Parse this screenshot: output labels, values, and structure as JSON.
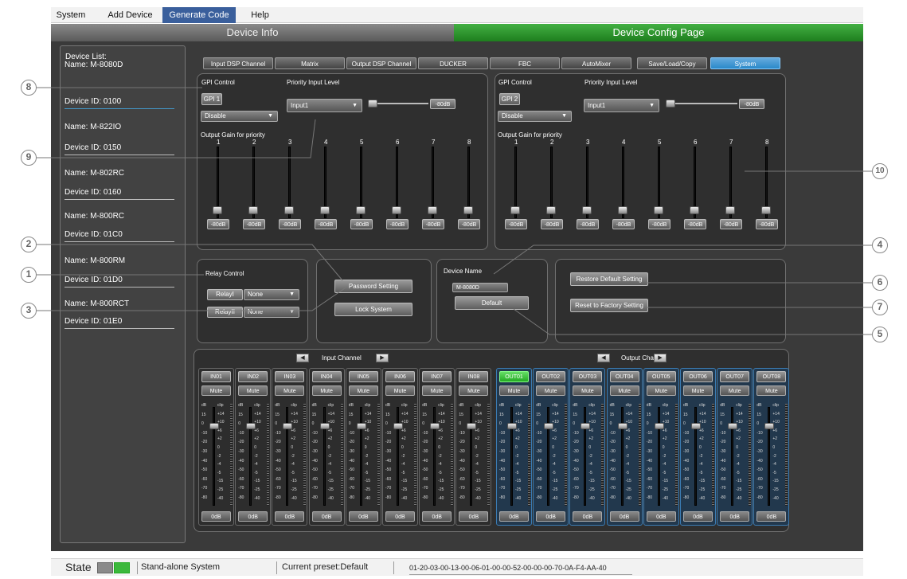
{
  "menu": {
    "items": [
      "System",
      "Add Device",
      "Generate Code",
      "Help"
    ],
    "active": "Generate Code"
  },
  "header": {
    "left": "Device Info",
    "right": "Device Config Page"
  },
  "device_list": {
    "title": "Device List:",
    "devices": [
      {
        "name": "Name:  M-8080D",
        "id": "Device ID: 0100"
      },
      {
        "name": "Name:  M-822IO",
        "id": "Device ID: 0150"
      },
      {
        "name": "Name:  M-802RC",
        "id": "Device ID: 0160"
      },
      {
        "name": "Name:  M-800RC",
        "id": "Device ID: 01C0"
      },
      {
        "name": "Name:  M-800RM",
        "id": "Device ID: 01D0"
      },
      {
        "name": "Name:  M-800RCT",
        "id": "Device ID: 01E0"
      }
    ]
  },
  "tabs": [
    "Input DSP Channel",
    "Matrix",
    "Output DSP Channel",
    "DUCKER",
    "FBC",
    "AutoMixer",
    "Save/Load/Copy",
    "System"
  ],
  "active_tab": "System",
  "gpi_left": {
    "gpi_label": "GPI Control",
    "priority_label": "Priority Input Level",
    "gpi_button": "GPI 1",
    "mode": "Disable",
    "input": "Input1",
    "level": "-80dB",
    "output_gain_label": "Output Gain for priority",
    "channels": [
      "1",
      "2",
      "3",
      "4",
      "5",
      "6",
      "7",
      "8"
    ],
    "values": [
      "-80dB",
      "-80dB",
      "-80dB",
      "-80dB",
      "-80dB",
      "-80dB",
      "-80dB",
      "-80dB"
    ]
  },
  "gpi_right": {
    "gpi_label": "GPI Control",
    "priority_label": "Priority Input Level",
    "gpi_button": "GPI 2",
    "mode": "Disable",
    "input": "Input1",
    "level": "-80dB",
    "output_gain_label": "Output Gain for priority",
    "channels": [
      "1",
      "2",
      "3",
      "4",
      "5",
      "6",
      "7",
      "8"
    ],
    "values": [
      "-80dB",
      "-80dB",
      "-80dB",
      "-80dB",
      "-80dB",
      "-80dB",
      "-80dB",
      "-80dB"
    ]
  },
  "relay": {
    "title": "Relay Control",
    "relay1": "RelayI",
    "relay1_value": "None",
    "relay2": "RelayII",
    "relay2_value": "None"
  },
  "security": {
    "password": "Password Setting",
    "lock": "Lock System"
  },
  "device_name": {
    "label": "Device Name",
    "value": "M-8080D",
    "default_button": "Default"
  },
  "restore": {
    "restore_default": "Restore Default Setting",
    "reset_factory": "Reset to Factory Setting"
  },
  "input_channel_label": "Input Channel",
  "output_channel_label": "Output Channel",
  "input_channels": [
    "IN01",
    "IN02",
    "IN03",
    "IN04",
    "IN05",
    "IN06",
    "IN07",
    "IN08"
  ],
  "output_channels": [
    "OUT01",
    "OUT02",
    "OUT03",
    "OUT04",
    "OUT05",
    "OUT06",
    "OUT07",
    "OUT08"
  ],
  "mute_label": "Mute",
  "channel_gain": "0dB",
  "scale_left": [
    "dB",
    "15",
    "0",
    "-10",
    "-20",
    "-30",
    "-40",
    "-50",
    "-60",
    "-70",
    "-80"
  ],
  "scale_right": [
    "clip",
    "+14",
    "+10",
    "+6",
    "+2",
    "0",
    "-2",
    "-4",
    "-5",
    "-15",
    "-25",
    "-40"
  ],
  "callouts": [
    "8",
    "9",
    "2",
    "1",
    "3",
    "4",
    "6",
    "7",
    "5",
    "10"
  ],
  "status": {
    "state_label": "State",
    "mode": "Stand-alone System",
    "preset": "Current preset:Default",
    "code": "01-20-03-00-13-00-06-01-00-00-52-00-00-00-70-0A-F4-AA-40",
    "indicator_colors": [
      "#8a8a8a",
      "#3cb83c"
    ]
  }
}
